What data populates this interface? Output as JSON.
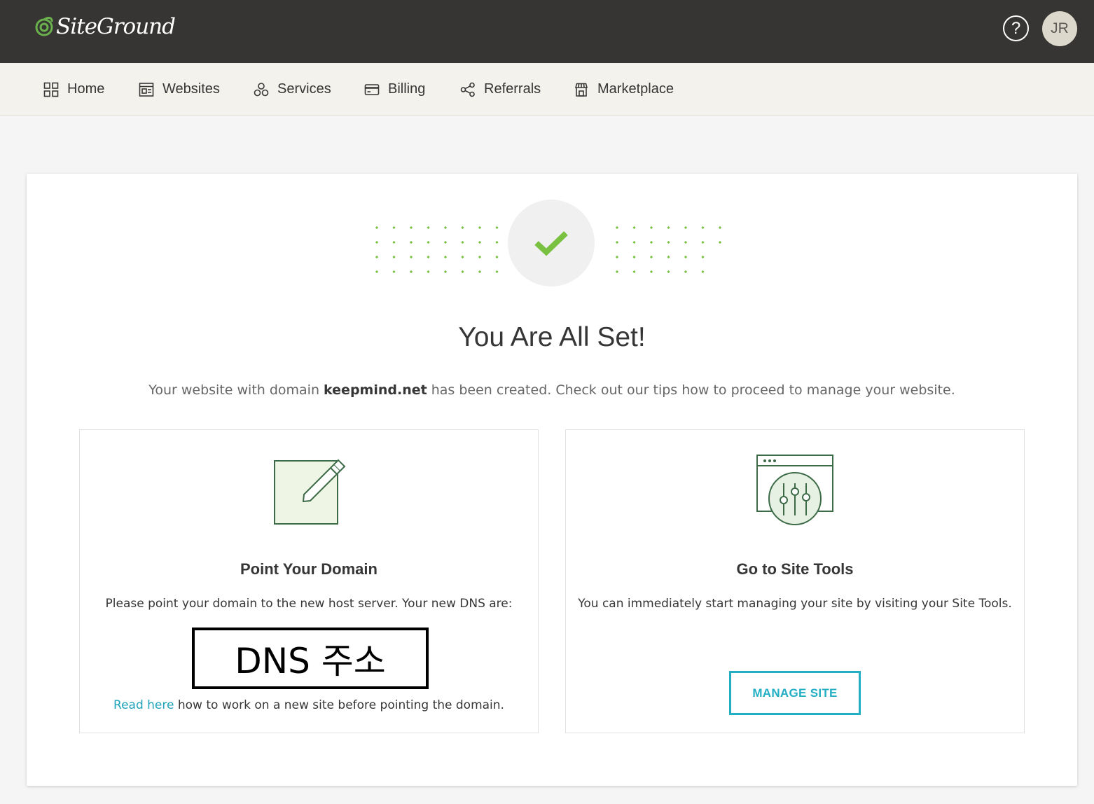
{
  "brand": {
    "name": "SiteGround",
    "logo_color": "#6ab04c"
  },
  "header": {
    "help_glyph": "?",
    "user_initials": "JR"
  },
  "nav": {
    "items": [
      {
        "label": "Home",
        "icon": "grid-icon"
      },
      {
        "label": "Websites",
        "icon": "websites-icon"
      },
      {
        "label": "Services",
        "icon": "services-icon"
      },
      {
        "label": "Billing",
        "icon": "card-icon"
      },
      {
        "label": "Referrals",
        "icon": "share-icon"
      },
      {
        "label": "Marketplace",
        "icon": "store-icon"
      }
    ]
  },
  "main": {
    "title": "You Are All Set!",
    "subtitle_before": "Your website with domain ",
    "domain": "keepmind.net",
    "subtitle_after": " has been created. Check out our tips how to proceed to manage your website."
  },
  "point_domain": {
    "title": "Point Your Domain",
    "text": "Please point your domain to the new host server. Your new DNS are:",
    "dns_placeholder": "DNS 주소",
    "read_here_link": "Read here",
    "read_here_rest": " how to work on a new site before pointing the domain."
  },
  "site_tools": {
    "title": "Go to Site Tools",
    "text": "You can immediately start managing your site by visiting your Site Tools.",
    "button_label": "MANAGE SITE"
  },
  "colors": {
    "accent": "#22aec3",
    "success": "#7ac142",
    "icon_green": "#3d6b47",
    "topbar": "#363533"
  }
}
